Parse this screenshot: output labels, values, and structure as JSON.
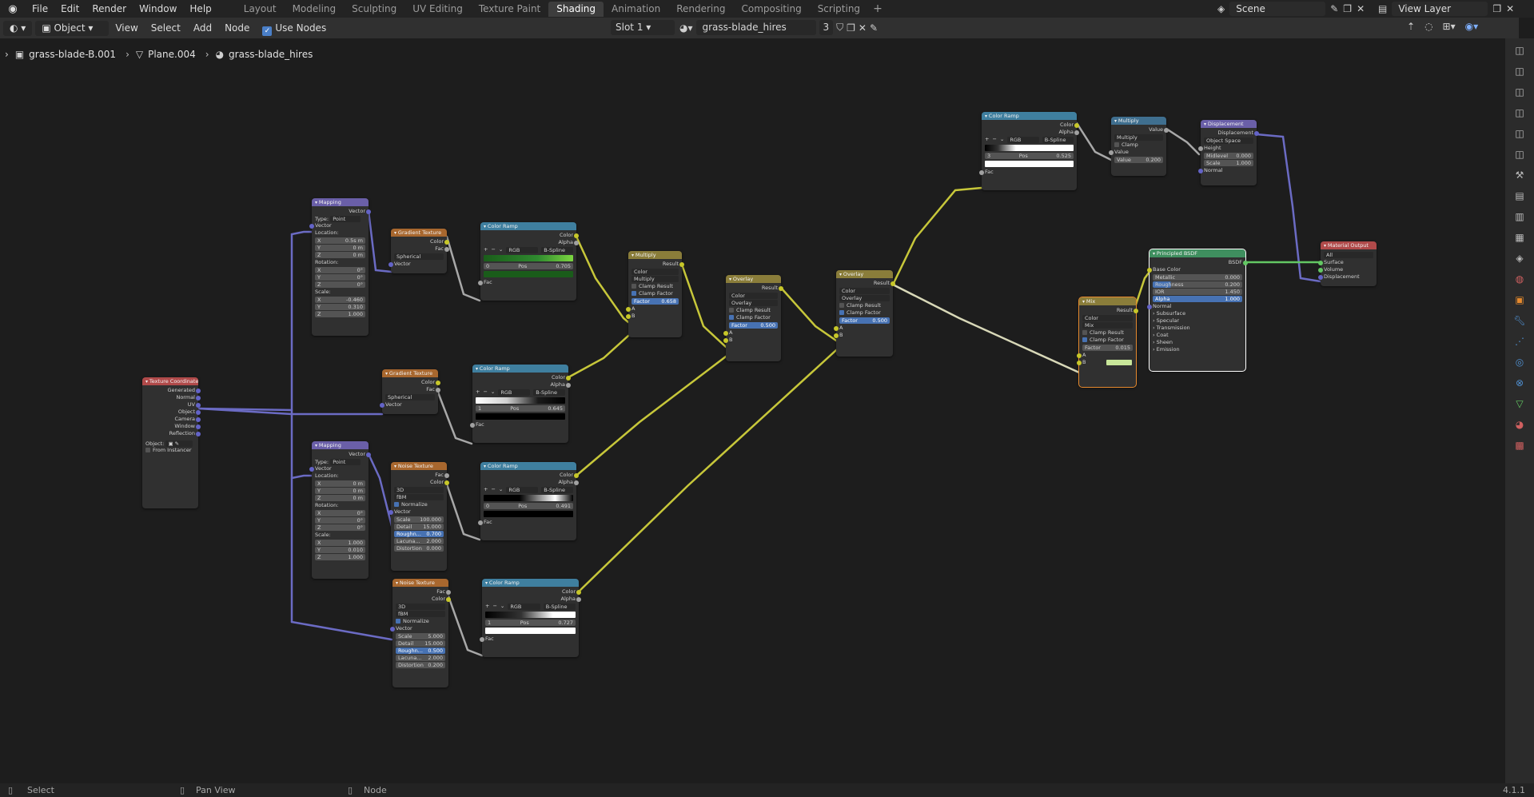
{
  "menu": {
    "items": [
      "File",
      "Edit",
      "Render",
      "Window",
      "Help"
    ]
  },
  "workspaces": [
    {
      "label": "Layout",
      "active": false
    },
    {
      "label": "Modeling",
      "active": false
    },
    {
      "label": "Sculpting",
      "active": false
    },
    {
      "label": "UV Editing",
      "active": false
    },
    {
      "label": "Texture Paint",
      "active": false
    },
    {
      "label": "Shading",
      "active": true
    },
    {
      "label": "Animation",
      "active": false
    },
    {
      "label": "Rendering",
      "active": false
    },
    {
      "label": "Compositing",
      "active": false
    },
    {
      "label": "Scripting",
      "active": false
    }
  ],
  "scene": {
    "name": "Scene"
  },
  "view_layer": {
    "name": "View Layer"
  },
  "header": {
    "mode": "Object",
    "view": "View",
    "select": "Select",
    "add": "Add",
    "node": "Node",
    "use_nodes": "Use Nodes",
    "slot": "Slot 1",
    "material": "grass-blade_hires",
    "users": "3"
  },
  "breadcrumb": {
    "object": "grass-blade-B.001",
    "mesh": "Plane.004",
    "material": "grass-blade_hires"
  },
  "status": {
    "select": "Select",
    "pan": "Pan View",
    "node": "Node",
    "version": "4.1.1"
  },
  "nodes": {
    "tex_coord": {
      "title": "Texture Coordinate",
      "outputs": [
        "Generated",
        "Normal",
        "UV",
        "Object",
        "Camera",
        "Window",
        "Reflection"
      ],
      "object_label": "Object:",
      "from_instancer": "From Instancer"
    },
    "mapping1": {
      "title": "Mapping",
      "out": "Vector",
      "type_label": "Type:",
      "type": "Point",
      "vector": "Vector",
      "location": "Location:",
      "loc": [
        [
          "X",
          "0.5s m"
        ],
        [
          "Y",
          "0 m"
        ],
        [
          "Z",
          "0 m"
        ]
      ],
      "rotation": "Rotation:",
      "rot": [
        [
          "X",
          "0°"
        ],
        [
          "Y",
          "0°"
        ],
        [
          "Z",
          "0°"
        ]
      ],
      "scale": "Scale:",
      "scl": [
        [
          "X",
          "-0.460"
        ],
        [
          "Y",
          "0.310"
        ],
        [
          "Z",
          "1.000"
        ]
      ]
    },
    "mapping2": {
      "title": "Mapping",
      "out": "Vector",
      "type_label": "Type:",
      "type": "Point",
      "vector": "Vector",
      "location": "Location:",
      "loc": [
        [
          "X",
          "0 m"
        ],
        [
          "Y",
          "0 m"
        ],
        [
          "Z",
          "0 m"
        ]
      ],
      "rotation": "Rotation:",
      "rot": [
        [
          "X",
          "0°"
        ],
        [
          "Y",
          "0°"
        ],
        [
          "Z",
          "0°"
        ]
      ],
      "scale": "Scale:",
      "scl": [
        [
          "X",
          "1.000"
        ],
        [
          "Y",
          "0.010"
        ],
        [
          "Z",
          "1.000"
        ]
      ]
    },
    "grad1": {
      "title": "Gradient Texture",
      "outputs": [
        "Color",
        "Fac"
      ],
      "type": "Spherical",
      "vector": "Vector"
    },
    "grad2": {
      "title": "Gradient Texture",
      "outputs": [
        "Color",
        "Fac"
      ],
      "type": "Spherical",
      "vector": "Vector"
    },
    "noise1": {
      "title": "Noise Texture",
      "outputs": [
        "Fac",
        "Color"
      ],
      "dim": "3D",
      "type": "fBM",
      "normalize": "Normalize",
      "vector": "Vector",
      "fields": [
        [
          "Scale",
          "100.000"
        ],
        [
          "Detail",
          "15.000"
        ],
        [
          "Roughn...",
          "0.700"
        ],
        [
          "Lacuna...",
          "2.000"
        ],
        [
          "Distortion",
          "0.000"
        ]
      ]
    },
    "noise2": {
      "title": "Noise Texture",
      "outputs": [
        "Fac",
        "Color"
      ],
      "dim": "3D",
      "type": "fBM",
      "normalize": "Normalize",
      "vector": "Vector",
      "fields": [
        [
          "Scale",
          "5.000"
        ],
        [
          "Detail",
          "15.000"
        ],
        [
          "Roughn...",
          "0.500"
        ],
        [
          "Lacuna...",
          "2.000"
        ],
        [
          "Distortion",
          "0.200"
        ]
      ]
    },
    "ramp1": {
      "title": "Color Ramp",
      "outputs": [
        "Color",
        "Alpha"
      ],
      "mode": "RGB",
      "interp": "B-Spline",
      "index": "0",
      "pos_label": "Pos",
      "pos": "0.705",
      "fac": "Fac"
    },
    "ramp2": {
      "title": "Color Ramp",
      "outputs": [
        "Color",
        "Alpha"
      ],
      "mode": "RGB",
      "interp": "B-Spline",
      "index": "1",
      "pos_label": "Pos",
      "pos": "0.645",
      "fac": "Fac"
    },
    "ramp3": {
      "title": "Color Ramp",
      "outputs": [
        "Color",
        "Alpha"
      ],
      "mode": "RGB",
      "interp": "B-Spline",
      "index": "0",
      "pos_label": "Pos",
      "pos": "0.491",
      "fac": "Fac"
    },
    "ramp4": {
      "title": "Color Ramp",
      "outputs": [
        "Color",
        "Alpha"
      ],
      "mode": "RGB",
      "interp": "B-Spline",
      "index": "1",
      "pos_label": "Pos",
      "pos": "0.727",
      "fac": "Fac"
    },
    "ramp5": {
      "title": "Color Ramp",
      "outputs": [
        "Color",
        "Alpha"
      ],
      "mode": "RGB",
      "interp": "B-Spline",
      "index": "3",
      "pos_label": "Pos",
      "pos": "0.525",
      "fac": "Fac"
    },
    "multiply": {
      "title": "Multiply",
      "out": "Result",
      "type": "Color",
      "blend": "Multiply",
      "clamp_result": "Clamp Result",
      "clamp_factor": "Clamp Factor",
      "factor_label": "Factor",
      "factor": "0.658",
      "a": "A",
      "b": "B"
    },
    "overlay1": {
      "title": "Overlay",
      "out": "Result",
      "type": "Color",
      "blend": "Overlay",
      "clamp_result": "Clamp Result",
      "clamp_factor": "Clamp Factor",
      "factor_label": "Factor",
      "factor": "0.500",
      "a": "A",
      "b": "B"
    },
    "overlay2": {
      "title": "Overlay",
      "out": "Result",
      "type": "Color",
      "blend": "Overlay",
      "clamp_result": "Clamp Result",
      "clamp_factor": "Clamp Factor",
      "factor_label": "Factor",
      "factor": "0.500",
      "a": "A",
      "b": "B"
    },
    "mix": {
      "title": "Mix",
      "out": "Result",
      "type": "Color",
      "blend": "Mix",
      "clamp_result": "Clamp Result",
      "clamp_factor": "Clamp Factor",
      "factor_label": "Factor",
      "factor": "0.015",
      "a": "A",
      "b": "B"
    },
    "math": {
      "title": "Multiply",
      "out": "Value",
      "op": "Multiply",
      "clamp": "Clamp",
      "value": "Value",
      "value2_label": "Value",
      "value2": "0.200"
    },
    "displacement": {
      "title": "Displacement",
      "out": "Displacement",
      "space": "Object Space",
      "height": "Height",
      "fields": [
        [
          "Midlevel",
          "0.000"
        ],
        [
          "Scale",
          "1.000"
        ]
      ],
      "normal": "Normal"
    },
    "bsdf": {
      "title": "Principled BSDF",
      "out": "BSDF",
      "base_color": "Base Color",
      "fields": [
        [
          "Metallic",
          "0.000"
        ],
        [
          "Roughness",
          "0.200"
        ],
        [
          "IOR",
          "1.450"
        ],
        [
          "Alpha",
          "1.000"
        ]
      ],
      "normal": "Normal",
      "panels": [
        "Subsurface",
        "Specular",
        "Transmission",
        "Coat",
        "Sheen",
        "Emission"
      ]
    },
    "output": {
      "title": "Material Output",
      "target": "All",
      "inputs": [
        "Surface",
        "Volume",
        "Displacement"
      ]
    }
  }
}
